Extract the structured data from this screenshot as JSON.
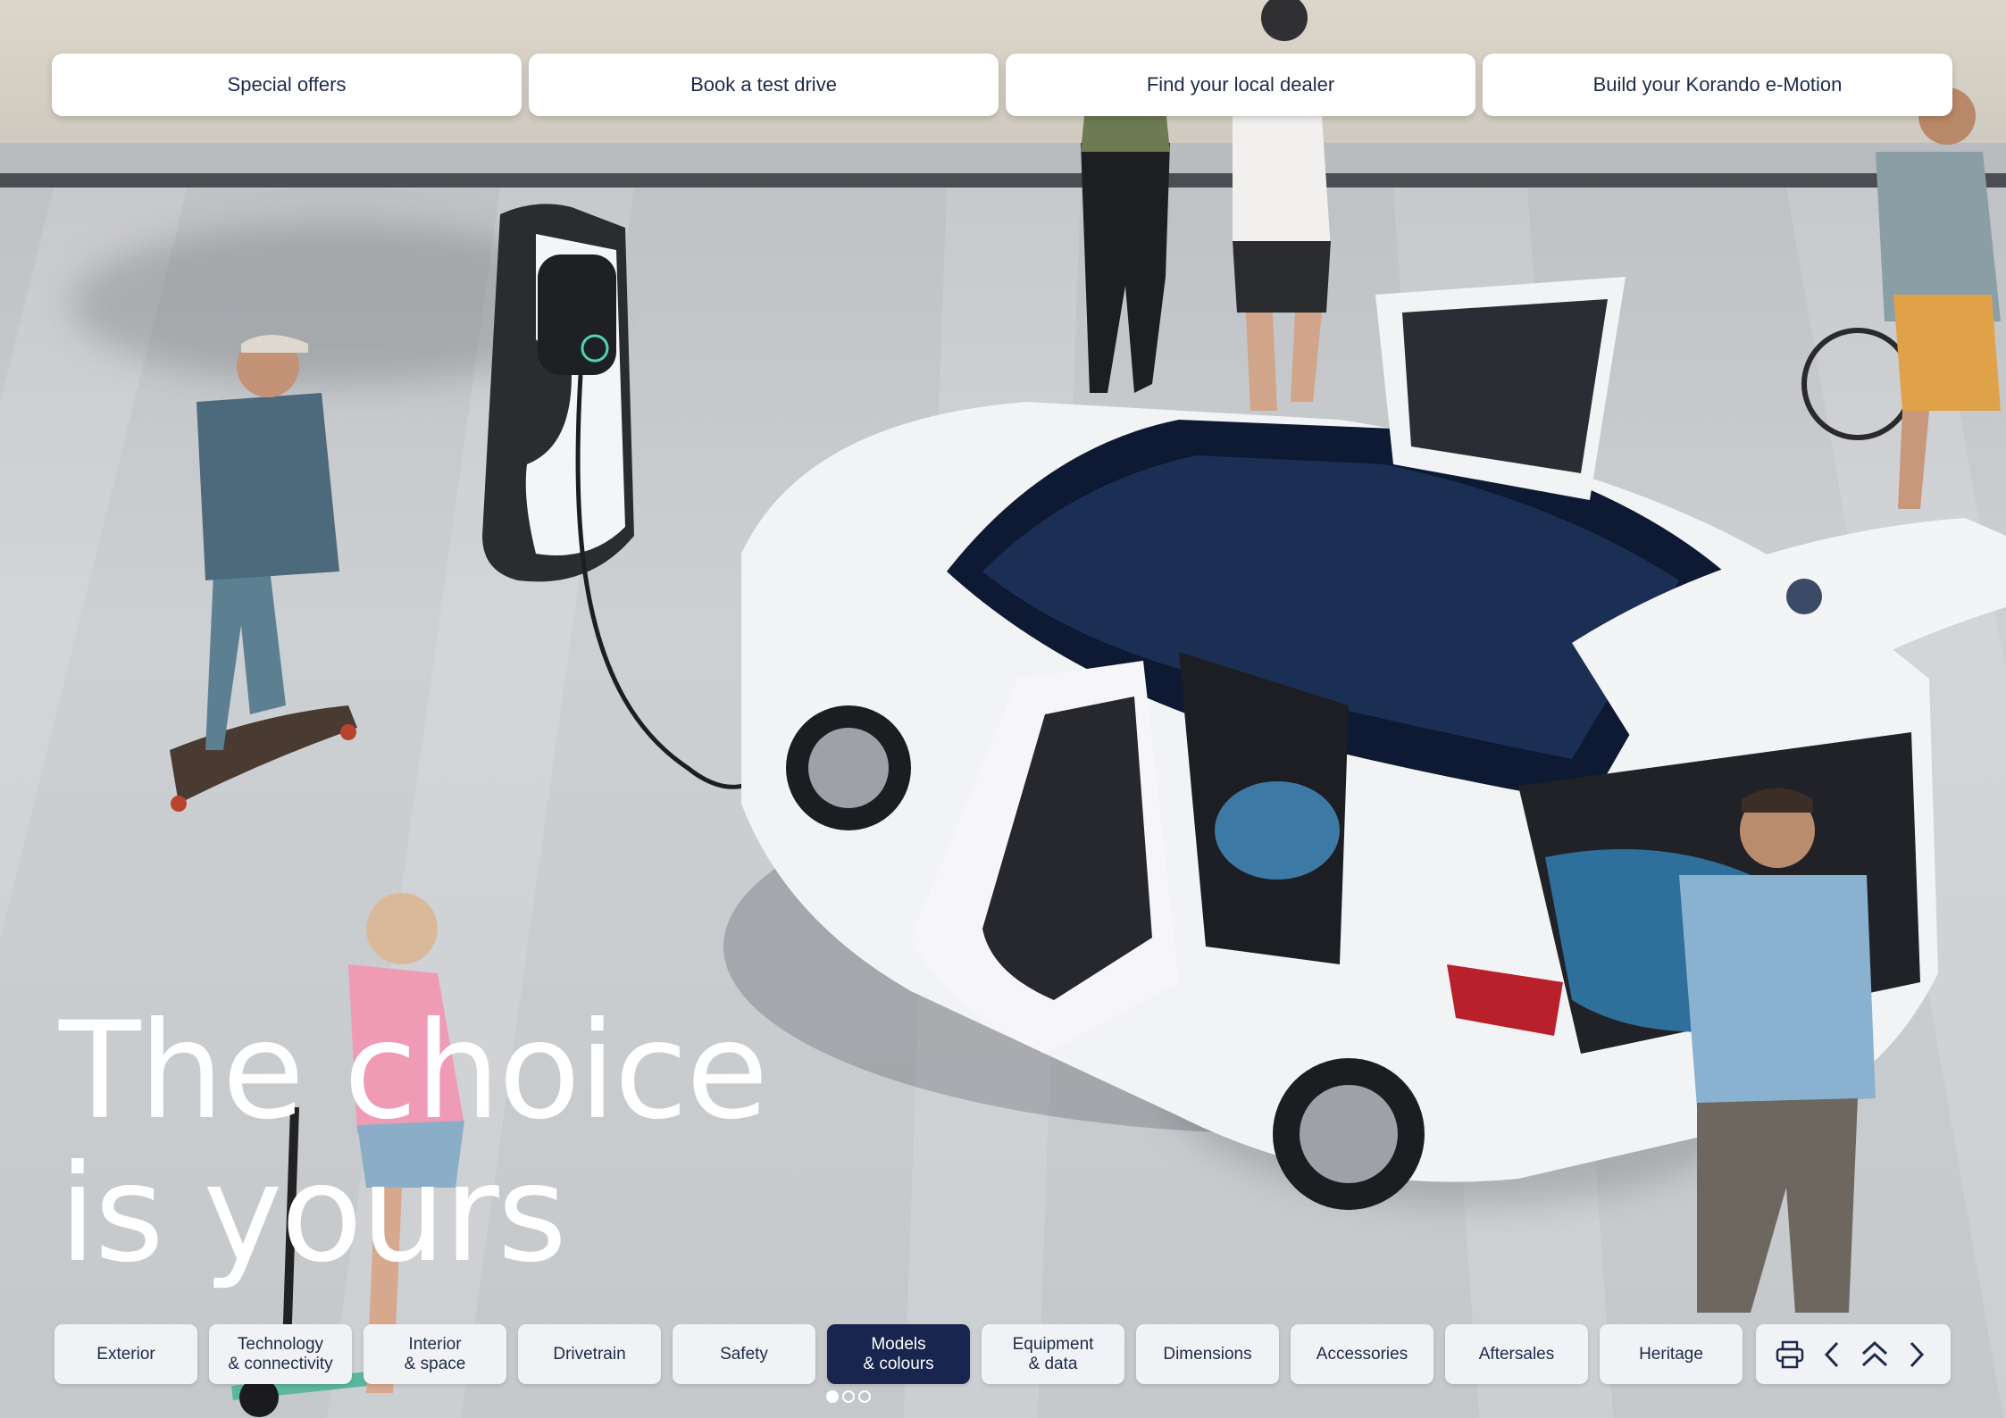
{
  "top_actions": {
    "special_offers": "Special offers",
    "test_drive": "Book a test drive",
    "dealer": "Find your local dealer",
    "build": "Build your Korando e-Motion"
  },
  "hero": {
    "line1": "The choice",
    "line2": "is yours"
  },
  "bottom_nav": {
    "items": [
      {
        "label": "Exterior"
      },
      {
        "label": "Technology\n& connectivity"
      },
      {
        "label": "Interior\n& space"
      },
      {
        "label": "Drivetrain"
      },
      {
        "label": "Safety"
      },
      {
        "label": "Models\n& colours",
        "active": true
      },
      {
        "label": "Equipment\n& data"
      },
      {
        "label": "Dimensions"
      },
      {
        "label": "Accessories"
      },
      {
        "label": "Aftersales"
      },
      {
        "label": "Heritage"
      }
    ],
    "active_color": "#17254f",
    "text_color": "#1e2a4a"
  },
  "tools": {
    "icons": [
      "print-icon",
      "chevron-left-icon",
      "double-chevron-up-icon",
      "chevron-right-icon"
    ]
  },
  "pager": {
    "count": 3,
    "current": 1
  }
}
